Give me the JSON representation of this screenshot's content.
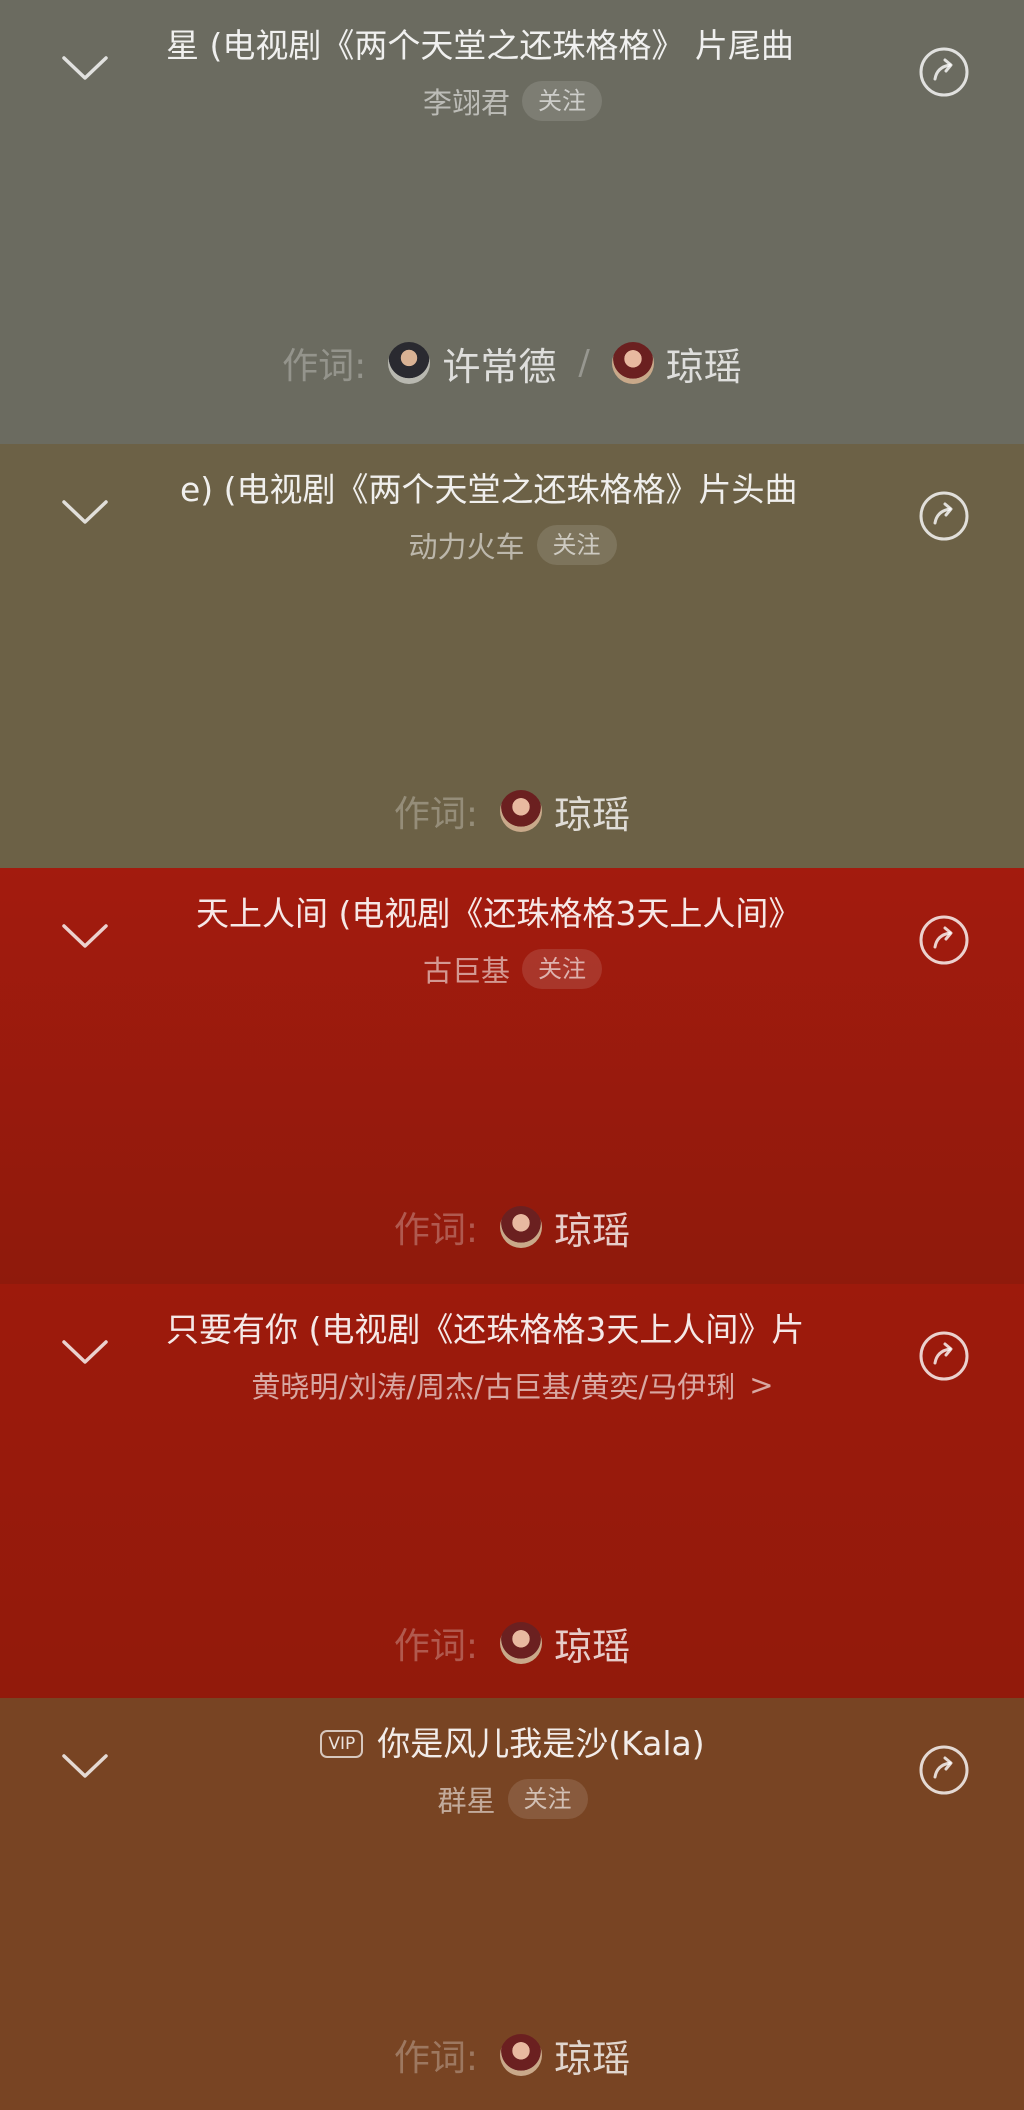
{
  "colors": {
    "panel_1": "#6b6b60",
    "panel_2": "#6c6146",
    "panel_3": "#a01a0e",
    "panel_4": "#98190c",
    "panel_5": "#784423"
  },
  "panels": [
    {
      "title": "星 (电视剧《两个天堂之还珠格格》 片尾曲",
      "artist": "李翊君",
      "follow": "关注",
      "credit_label": "作词:",
      "lyricist_1": "许常德",
      "separator": "/",
      "lyricist_2": "琼瑶"
    },
    {
      "title": "e) (电视剧《两个天堂之还珠格格》片头曲",
      "artist": "动力火车",
      "follow": "关注",
      "credit_label": "作词:",
      "lyricist": "琼瑶"
    },
    {
      "title": "天上人间 (电视剧《还珠格格3天上人间》",
      "artist": "古巨基",
      "follow": "关注",
      "credit_label": "作词:",
      "lyricist": "琼瑶"
    },
    {
      "title": "只要有你 (电视剧《还珠格格3天上人间》片",
      "artists": "黄晓明/刘涛/周杰/古巨基/黄奕/马伊琍",
      "more": ">",
      "credit_label": "作词:",
      "lyricist": "琼瑶"
    },
    {
      "vip": "VIP",
      "title": "你是风儿我是沙(Kala)",
      "artist": "群星",
      "follow": "关注",
      "credit_label": "作词:",
      "lyricist": "琼瑶"
    }
  ]
}
